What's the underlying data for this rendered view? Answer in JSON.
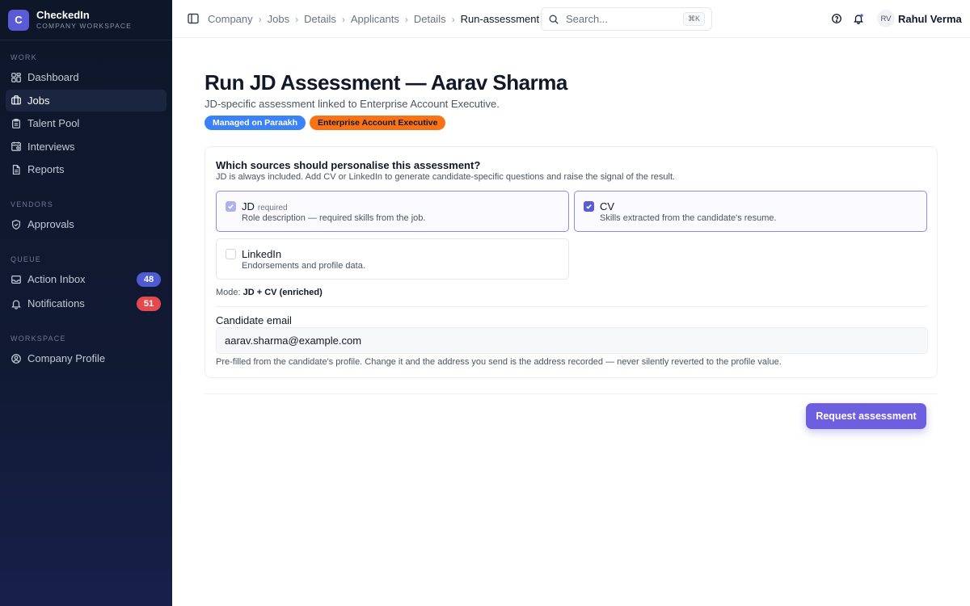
{
  "brand": {
    "logo_letter": "C",
    "name": "CheckedIn",
    "subtitle": "COMPANY WORKSPACE"
  },
  "sidebar": {
    "sections": [
      {
        "label": "WORK",
        "items": [
          {
            "label": "Dashboard",
            "icon": "dashboard-icon"
          },
          {
            "label": "Jobs",
            "icon": "briefcase-icon",
            "active": true
          },
          {
            "label": "Talent Pool",
            "icon": "clipboard-icon"
          },
          {
            "label": "Interviews",
            "icon": "calendar-icon"
          },
          {
            "label": "Reports",
            "icon": "document-icon"
          }
        ]
      },
      {
        "label": "VENDORS",
        "items": [
          {
            "label": "Approvals",
            "icon": "shield-check-icon"
          }
        ]
      },
      {
        "label": "QUEUE",
        "items": [
          {
            "label": "Action Inbox",
            "icon": "inbox-icon",
            "badge": "48",
            "badge_color": "#4f5bd5"
          },
          {
            "label": "Notifications",
            "icon": "bell-icon",
            "badge": "51",
            "badge_color": "#e5484d"
          }
        ]
      },
      {
        "label": "WORKSPACE",
        "items": [
          {
            "label": "Company Profile",
            "icon": "user-circle-icon"
          }
        ]
      }
    ]
  },
  "topbar": {
    "breadcrumb": [
      "Company",
      "Jobs",
      "Details",
      "Applicants",
      "Details",
      "Run-assessment"
    ],
    "search_placeholder": "Search...",
    "search_shortcut": "⌘K",
    "user_initials": "RV",
    "user_name": "Rahul Verma"
  },
  "page": {
    "title": "Run JD Assessment — Aarav Sharma",
    "subtitle": "JD-specific assessment linked to Enterprise Account Executive.",
    "tags": [
      {
        "label": "Managed on Paraakh",
        "color": "#3b82f6"
      },
      {
        "label": "Enterprise Account Executive",
        "color": "#f97316"
      }
    ]
  },
  "sources": {
    "title": "Which sources should personalise this assessment?",
    "description": "JD is always included. Add CV or LinkedIn to generate candidate-specific questions and raise the signal of the result.",
    "options": [
      {
        "title": "JD",
        "tag": "required",
        "description": "Role description — required skills from the job.",
        "checked": true,
        "disabled": true
      },
      {
        "title": "CV",
        "tag": "",
        "description": "Skills extracted from the candidate's resume.",
        "checked": true,
        "disabled": false
      },
      {
        "title": "LinkedIn",
        "tag": "",
        "description": "Endorsements and profile data.",
        "checked": false,
        "disabled": false
      }
    ],
    "mode_label": "Mode:",
    "mode_value": "JD + CV (enriched)"
  },
  "email": {
    "label": "Candidate email",
    "value": "aarav.sharma@example.com",
    "hint": "Pre-filled from the candidate's profile. Change it and the address you send is the address recorded — never silently reverted to the profile value."
  },
  "actions": {
    "primary_label": "Request assessment"
  }
}
